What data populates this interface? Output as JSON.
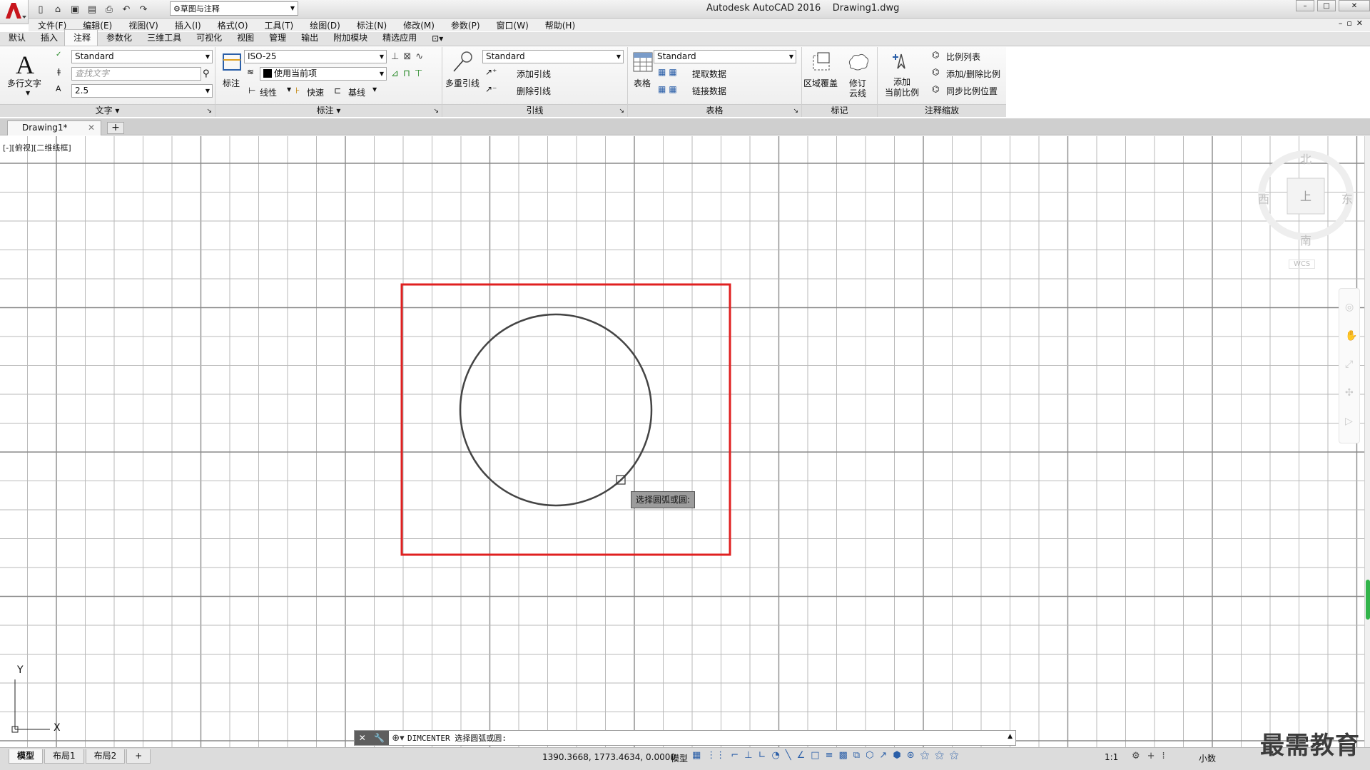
{
  "app": {
    "logo_letter": "A",
    "workspace": "草图与注释",
    "title": "Autodesk AutoCAD 2016    Drawing1.dwg",
    "window_controls": [
      "–",
      "□",
      "✕"
    ]
  },
  "menu": [
    "文件(F)",
    "编辑(E)",
    "视图(V)",
    "插入(I)",
    "格式(O)",
    "工具(T)",
    "绘图(D)",
    "标注(N)",
    "修改(M)",
    "参数(P)",
    "窗口(W)",
    "帮助(H)"
  ],
  "ribbon_tabs": [
    "默认",
    "插入",
    "注释",
    "参数化",
    "三维工具",
    "可视化",
    "视图",
    "管理",
    "输出",
    "附加模块",
    "精选应用"
  ],
  "active_ribbon_tab": "注释",
  "ribbon": {
    "text_panel": {
      "title": "文字",
      "mtext_label": "多行文字",
      "style": "Standard",
      "find_placeholder": "查找文字",
      "height": "2.5"
    },
    "dim_panel": {
      "title": "标注",
      "dim_label": "标注",
      "dim_style": "ISO-25",
      "layer": "使用当前项",
      "linear": "线性",
      "quick": "快速",
      "baseline": "基线"
    },
    "leader_panel": {
      "title": "引线",
      "mleader_label": "多重引线",
      "style": "Standard",
      "add_leader": "添加引线",
      "remove_leader": "删除引线"
    },
    "table_panel": {
      "title": "表格",
      "table_label": "表格",
      "style": "Standard",
      "extract": "提取数据",
      "link": "链接数据"
    },
    "markup_panel": {
      "title": "标记",
      "wipeout": "区域覆盖",
      "revcloud_line1": "修订",
      "revcloud_line2": "云线"
    },
    "scale_panel": {
      "title": "注释缩放",
      "add_line1": "添加",
      "add_line2": "当前比例",
      "scale_list": "比例列表",
      "add_delete": "添加/删除比例",
      "sync": "同步比例位置"
    }
  },
  "doc_tabs": [
    "Drawing1*"
  ],
  "viewport_label": "[-][俯视][二维线框]",
  "viewcube": {
    "north": "北",
    "south": "南",
    "east": "东",
    "west": "西",
    "top": "上",
    "wcs": "WCS"
  },
  "tooltip": "选择圆弧或圆:",
  "ucs": {
    "x": "X",
    "y": "Y"
  },
  "command_line": "DIMCENTER 选择圆弧或圆:",
  "layout_tabs": [
    "模型",
    "布局1",
    "布局2"
  ],
  "status": {
    "coords": "1390.3668, 1773.4634, 0.0000",
    "space": "模型",
    "scale": "1:1",
    "units": "小数"
  },
  "watermark": "最需教育",
  "colors": {
    "highlight_rect": "#e02020",
    "app_red": "#c8161d",
    "status_blue": "#2b5fa8"
  }
}
